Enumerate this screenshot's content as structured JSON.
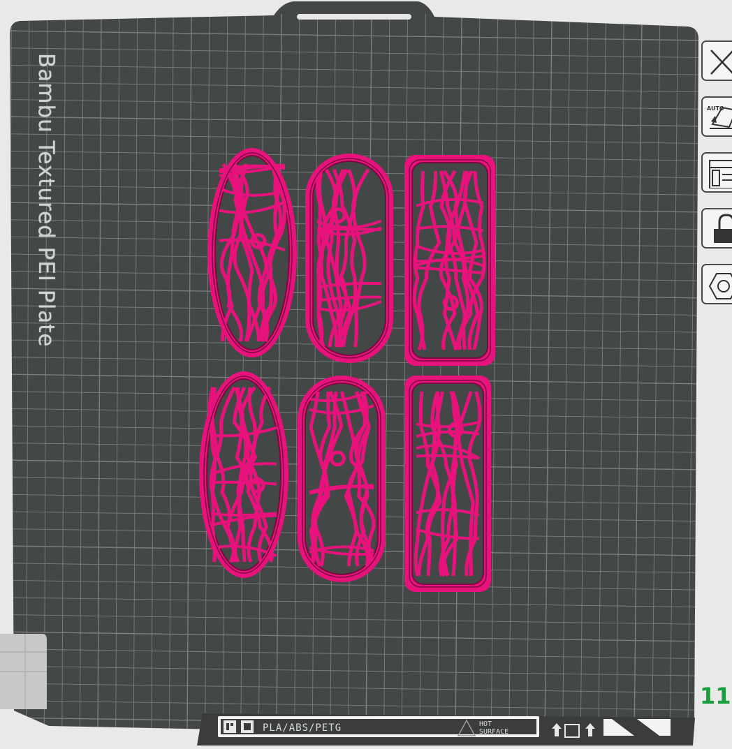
{
  "plate": {
    "name": "Bambu Textured PEI Plate",
    "colors": {
      "plate": "#434746",
      "grid": "#7b7f7e",
      "model": "#e8127c",
      "model_dark": "#7a0a3f",
      "background": "#e9e9e9"
    }
  },
  "bottom_strip": {
    "filament_types": "PLA/ABS/PETG",
    "hot_surface_line1": "HOT",
    "hot_surface_line2": "SURFACE"
  },
  "toolbar": {
    "items": [
      {
        "name": "close",
        "icon": "close-icon"
      },
      {
        "name": "auto-orient",
        "icon": "auto-orient-icon",
        "badge": "AUTO"
      },
      {
        "name": "arrange",
        "icon": "arrange-icon"
      },
      {
        "name": "lock",
        "icon": "unlock-icon"
      },
      {
        "name": "plate-settings",
        "icon": "hex-settings-icon"
      }
    ]
  },
  "plate_index": "11",
  "models": [
    {
      "name": "oval-stained-glass-1"
    },
    {
      "name": "capsule-stained-glass-1"
    },
    {
      "name": "rect-stained-glass-1"
    },
    {
      "name": "oval-stained-glass-2"
    },
    {
      "name": "capsule-stained-glass-2"
    },
    {
      "name": "rect-stained-glass-2"
    }
  ]
}
